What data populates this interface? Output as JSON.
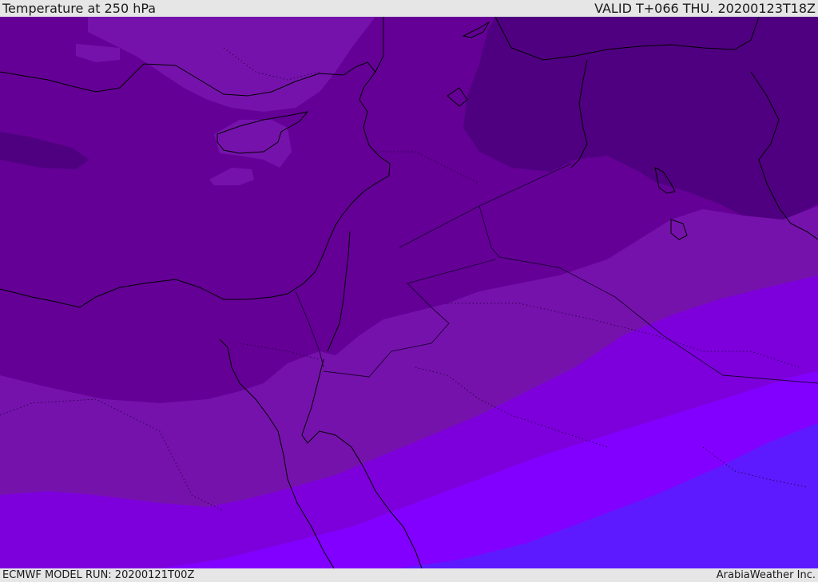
{
  "header": {
    "title": "Temperature at 250 hPa",
    "valid": "VALID T+066 THU. 20200123T18Z"
  },
  "footer": {
    "model_run": "ECMWF MODEL RUN: 20200121T00Z",
    "credit": "ArabiaWeather Inc."
  },
  "colors": {
    "band_coldest": "#4f0080",
    "band_cold": "#640096",
    "band_mid": "#7612ac",
    "band_warm": "#7d00dc",
    "band_warmer": "#8200ff",
    "band_warmest": "#5e1aff",
    "coastline": "#000000",
    "border": "#1a0033"
  }
}
